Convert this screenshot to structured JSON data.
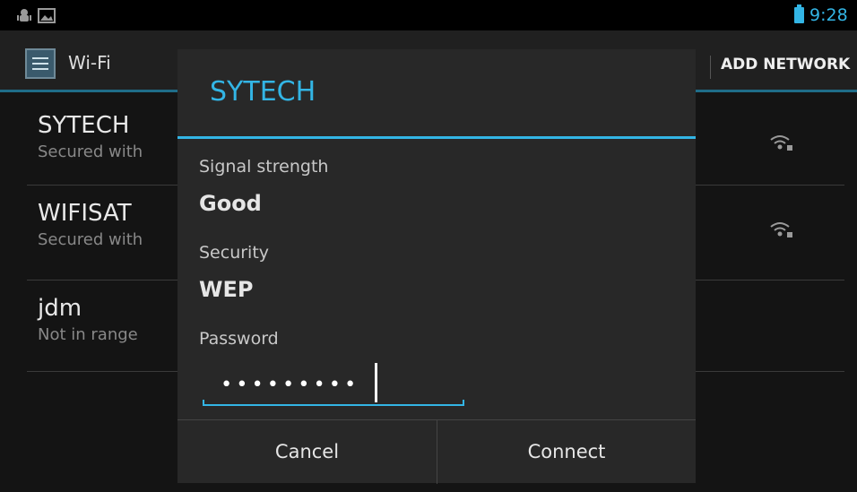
{
  "status_bar": {
    "time": "9:28",
    "icons": [
      "android-debug-icon",
      "image-notification-icon",
      "battery-charging-icon"
    ],
    "accent": "#33b5e5"
  },
  "action_bar": {
    "title": "Wi-Fi",
    "action": "ADD NETWORK",
    "icon": "wifi-settings-icon"
  },
  "networks": [
    {
      "name": "SYTECH",
      "status": "Secured with",
      "signal_icon": "wifi-locked-icon"
    },
    {
      "name": "WIFISAT",
      "status": "Secured with",
      "signal_icon": "wifi-locked-icon"
    },
    {
      "name": "jdm",
      "status": "Not in range"
    }
  ],
  "dialog": {
    "title": "SYTECH",
    "signal_label": "Signal strength",
    "signal_value": "Good",
    "security_label": "Security",
    "security_value": "WEP",
    "password_label": "Password",
    "password_value": "•••••••••",
    "cancel_label": "Cancel",
    "connect_label": "Connect"
  },
  "colors": {
    "accent": "#33b5e5",
    "dialog_bg": "#282828",
    "list_bg": "#141414"
  }
}
